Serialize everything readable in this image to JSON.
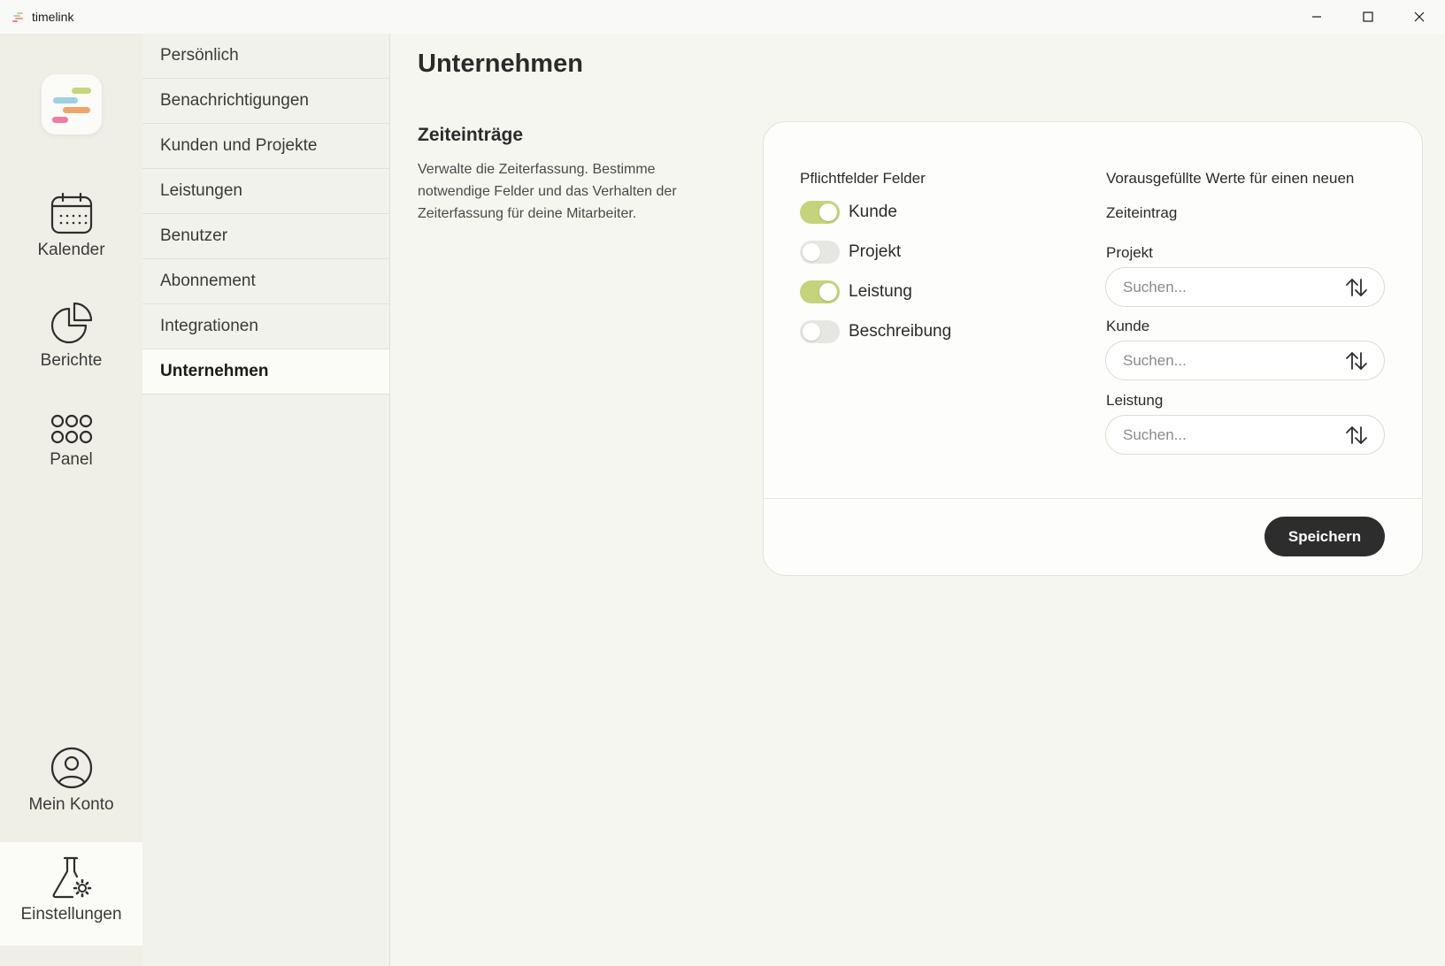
{
  "window": {
    "title": "timelink",
    "controls": [
      "minimize-icon",
      "maximize-icon",
      "close-icon"
    ]
  },
  "rail": {
    "items": [
      {
        "label": "Kalender",
        "icon": "calendar-icon"
      },
      {
        "label": "Berichte",
        "icon": "pie-chart-icon"
      },
      {
        "label": "Panel",
        "icon": "grid-icon"
      },
      {
        "label": "Mein Konto",
        "icon": "user-circle-icon"
      },
      {
        "label": "Einstellungen",
        "icon": "flask-gear-icon",
        "active": true
      }
    ]
  },
  "subnav": {
    "items": [
      {
        "label": "Persönlich"
      },
      {
        "label": "Benachrichtigungen"
      },
      {
        "label": "Kunden und Projekte"
      },
      {
        "label": "Leistungen"
      },
      {
        "label": "Benutzer"
      },
      {
        "label": "Abonnement"
      },
      {
        "label": "Integrationen"
      },
      {
        "label": "Unternehmen",
        "active": true
      }
    ]
  },
  "main": {
    "title": "Unternehmen",
    "section": {
      "title": "Zeiteinträge",
      "description": "Verwalte die Zeiterfassung. Bestimme notwendige Felder und das Verhalten der Zeiterfassung für deine Mitarbeiter."
    },
    "card": {
      "required_heading": "Pflichtfelder Felder",
      "toggles": [
        {
          "label": "Kunde",
          "on": true
        },
        {
          "label": "Projekt",
          "on": false
        },
        {
          "label": "Leistung",
          "on": true
        },
        {
          "label": "Beschreibung",
          "on": false
        }
      ],
      "prefill_heading": "Vorausgefüllte Werte für einen neuen",
      "prefill_subheading": "Zeiteintrag",
      "fields": [
        {
          "label": "Projekt",
          "placeholder": "Suchen..."
        },
        {
          "label": "Kunde",
          "placeholder": "Suchen..."
        },
        {
          "label": "Leistung",
          "placeholder": "Suchen..."
        }
      ],
      "save_label": "Speichern"
    }
  },
  "colors": {
    "toggle_on": "#c5d37a",
    "toggle_off": "#e6e6e2",
    "button_dark": "#2d2d2d",
    "logo_green": "#c8d67a",
    "logo_blue": "#9fcfe6",
    "logo_orange": "#f0a56a",
    "logo_pink": "#ee7ca6"
  }
}
